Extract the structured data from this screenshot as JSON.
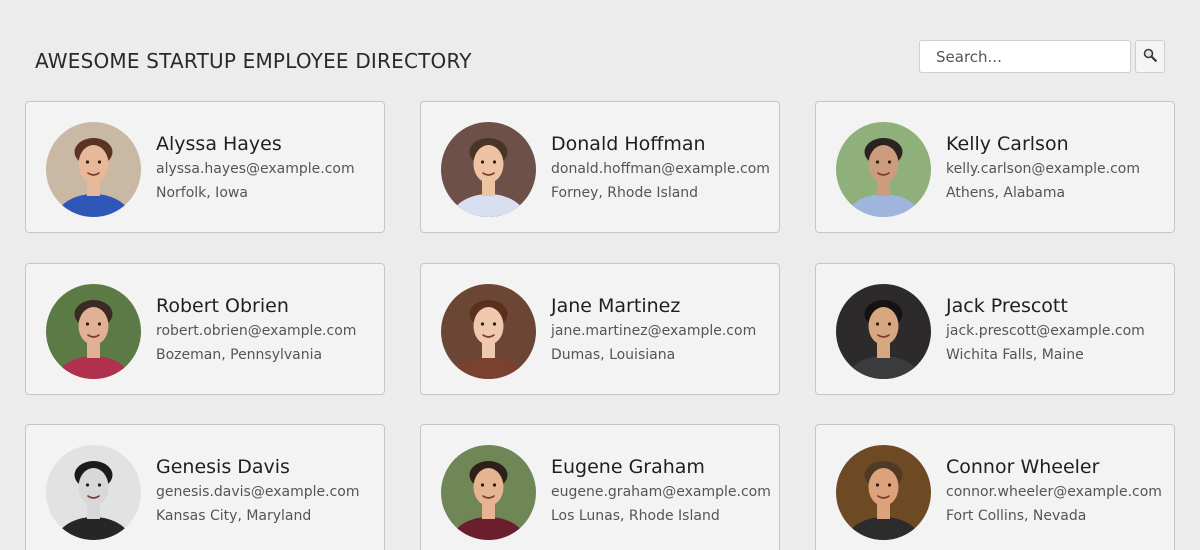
{
  "header": {
    "title": "AWESOME STARTUP EMPLOYEE DIRECTORY"
  },
  "search": {
    "placeholder": "Search...",
    "button_icon": "magnifier-icon"
  },
  "employees": [
    {
      "name": "Alyssa Hayes",
      "email": "alyssa.hayes@example.com",
      "location": "Norfolk, Iowa",
      "photo": {
        "bg": "#c9b9a4",
        "skin": "#e7b899",
        "hair": "#5a3324",
        "shirt": "#2f57b8"
      }
    },
    {
      "name": "Donald Hoffman",
      "email": "donald.hoffman@example.com",
      "location": "Forney, Rhode Island",
      "photo": {
        "bg": "#6d5048",
        "skin": "#eec3a4",
        "hair": "#4a3426",
        "shirt": "#d7dff0"
      }
    },
    {
      "name": "Kelly Carlson",
      "email": "kelly.carlson@example.com",
      "location": "Athens, Alabama",
      "photo": {
        "bg": "#8fb07a",
        "skin": "#cc9c7c",
        "hair": "#2b2320",
        "shirt": "#9fb5dd"
      }
    },
    {
      "name": "Robert Obrien",
      "email": "robert.obrien@example.com",
      "location": "Bozeman, Pennsylvania",
      "photo": {
        "bg": "#5b7a45",
        "skin": "#e2b095",
        "hair": "#3a2b22",
        "shirt": "#b0304e"
      }
    },
    {
      "name": "Jane Martinez",
      "email": "jane.martinez@example.com",
      "location": "Dumas, Louisiana",
      "photo": {
        "bg": "#6c4634",
        "skin": "#f0c8ad",
        "hair": "#5b2f1e",
        "shirt": "#7a4030"
      }
    },
    {
      "name": "Jack Prescott",
      "email": "jack.prescott@example.com",
      "location": "Wichita Falls, Maine",
      "photo": {
        "bg": "#2c2a2b",
        "skin": "#d7a880",
        "hair": "#141212",
        "shirt": "#3b3a3c"
      }
    },
    {
      "name": "Genesis Davis",
      "email": "genesis.davis@example.com",
      "location": "Kansas City, Maryland",
      "photo": {
        "bg": "#e2e2e2",
        "skin": "#d8d8d8",
        "hair": "#1b1b1b",
        "shirt": "#262626"
      }
    },
    {
      "name": "Eugene Graham",
      "email": "eugene.graham@example.com",
      "location": "Los Lunas, Rhode Island",
      "photo": {
        "bg": "#6f8657",
        "skin": "#e6b491",
        "hair": "#2c2018",
        "shirt": "#6b1f2c"
      }
    },
    {
      "name": "Connor Wheeler",
      "email": "connor.wheeler@example.com",
      "location": "Fort Collins, Nevada",
      "photo": {
        "bg": "#6d4a23",
        "skin": "#dba27c",
        "hair": "#4f3a26",
        "shirt": "#2c2c2c"
      }
    }
  ]
}
